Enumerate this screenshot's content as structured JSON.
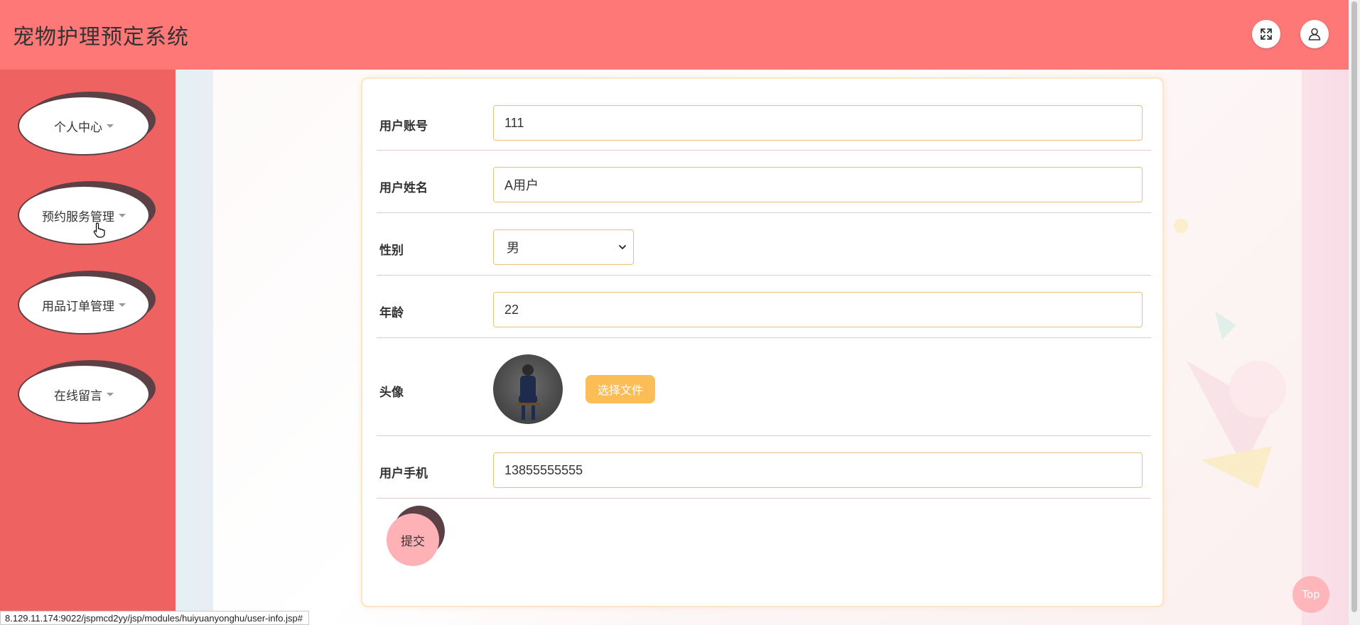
{
  "header": {
    "title": "宠物护理预定系统",
    "fullscreen_icon": "fullscreen-icon",
    "user_icon": "user-icon"
  },
  "sidebar": {
    "items": [
      {
        "label": "个人中心"
      },
      {
        "label": "预约服务管理"
      },
      {
        "label": "用品订单管理"
      },
      {
        "label": "在线留言"
      }
    ]
  },
  "form": {
    "account": {
      "label": "用户账号",
      "value": "111"
    },
    "name": {
      "label": "用户姓名",
      "value": "A用户"
    },
    "gender": {
      "label": "性别",
      "value": "男"
    },
    "age": {
      "label": "年龄",
      "value": "22"
    },
    "avatar": {
      "label": "头像",
      "button": "选择文件"
    },
    "phone": {
      "label": "用户手机",
      "value": "13855555555"
    },
    "submit": "提交"
  },
  "top_button": "Top",
  "status_url": "8.129.11.174:9022/jspmcd2yy/jsp/modules/huiyuanyonghu/user-info.jsp#",
  "colors": {
    "header": "#ff7878",
    "sidebar": "#ef6262",
    "accent": "#fbbd56",
    "submit": "#ffb2b6"
  }
}
